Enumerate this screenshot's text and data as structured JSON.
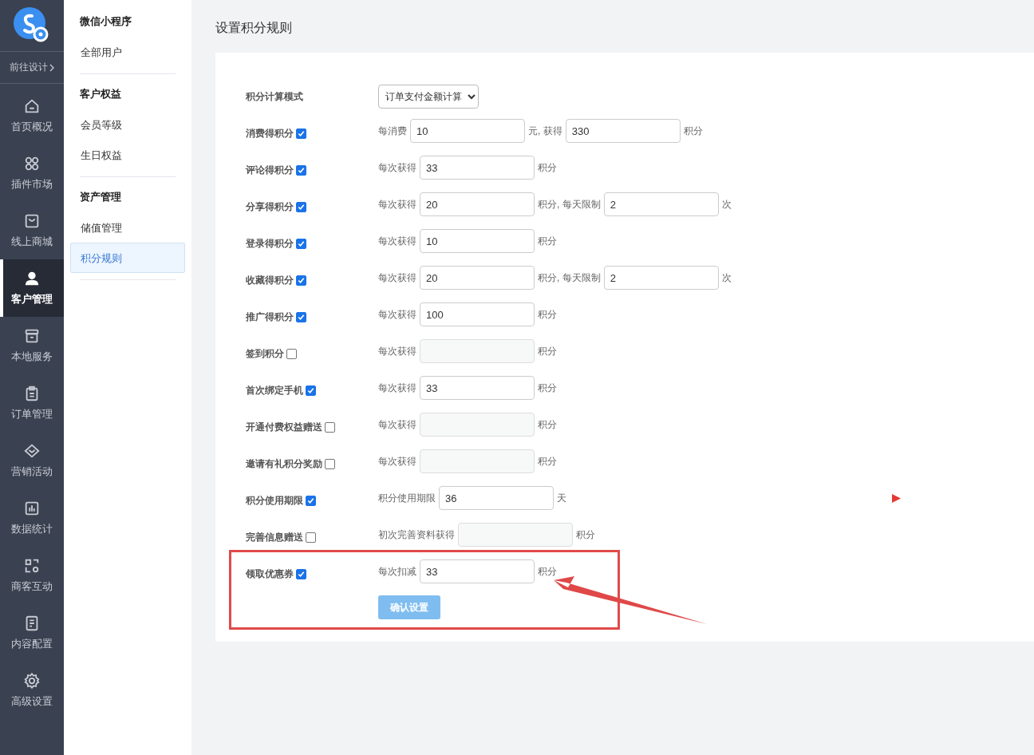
{
  "rail": {
    "design_link": "前往设计",
    "items": [
      {
        "label": "首页概况",
        "selected": false
      },
      {
        "label": "插件市场",
        "selected": false
      },
      {
        "label": "线上商城",
        "selected": false
      },
      {
        "label": "客户管理",
        "selected": true
      },
      {
        "label": "本地服务",
        "selected": false
      },
      {
        "label": "订单管理",
        "selected": false
      },
      {
        "label": "营销活动",
        "selected": false
      },
      {
        "label": "数据统计",
        "selected": false
      },
      {
        "label": "商客互动",
        "selected": false
      },
      {
        "label": "内容配置",
        "selected": false
      },
      {
        "label": "高级设置",
        "selected": false
      }
    ]
  },
  "subnav": {
    "groups": [
      {
        "title": "微信小程序",
        "items": [
          {
            "label": "全部用户",
            "selected": false
          }
        ]
      },
      {
        "title": "客户权益",
        "items": [
          {
            "label": "会员等级",
            "selected": false
          },
          {
            "label": "生日权益",
            "selected": false
          }
        ]
      },
      {
        "title": "资产管理",
        "items": [
          {
            "label": "储值管理",
            "selected": false
          },
          {
            "label": "积分规则",
            "selected": true
          }
        ]
      }
    ]
  },
  "page_title": "设置积分规则",
  "form": {
    "mode": {
      "label": "积分计算模式",
      "value": "订单支付金额计算"
    },
    "rows": [
      {
        "label": "消费得积分",
        "checked": true,
        "parts": [
          {
            "kind": "text",
            "text": "每消费"
          },
          {
            "kind": "input",
            "value": "10"
          },
          {
            "kind": "text",
            "text": "元, 获得"
          },
          {
            "kind": "input",
            "value": "330"
          },
          {
            "kind": "text",
            "text": "积分"
          }
        ]
      },
      {
        "label": "评论得积分",
        "checked": true,
        "parts": [
          {
            "kind": "text",
            "text": "每次获得"
          },
          {
            "kind": "input",
            "value": "33"
          },
          {
            "kind": "text",
            "text": "积分"
          }
        ]
      },
      {
        "label": "分享得积分",
        "checked": true,
        "parts": [
          {
            "kind": "text",
            "text": "每次获得"
          },
          {
            "kind": "input",
            "value": "20"
          },
          {
            "kind": "text",
            "text": "积分, 每天限制"
          },
          {
            "kind": "input",
            "value": "2"
          },
          {
            "kind": "text",
            "text": "次"
          }
        ]
      },
      {
        "label": "登录得积分",
        "checked": true,
        "parts": [
          {
            "kind": "text",
            "text": "每次获得"
          },
          {
            "kind": "input",
            "value": "10"
          },
          {
            "kind": "text",
            "text": "积分"
          }
        ]
      },
      {
        "label": "收藏得积分",
        "checked": true,
        "parts": [
          {
            "kind": "text",
            "text": "每次获得"
          },
          {
            "kind": "input",
            "value": "20"
          },
          {
            "kind": "text",
            "text": "积分, 每天限制"
          },
          {
            "kind": "input",
            "value": "2"
          },
          {
            "kind": "text",
            "text": "次"
          }
        ]
      },
      {
        "label": "推广得积分",
        "checked": true,
        "parts": [
          {
            "kind": "text",
            "text": "每次获得"
          },
          {
            "kind": "input",
            "value": "100"
          },
          {
            "kind": "text",
            "text": "积分"
          }
        ]
      },
      {
        "label": "签到积分",
        "checked": false,
        "parts": [
          {
            "kind": "text",
            "text": "每次获得"
          },
          {
            "kind": "input"
          },
          {
            "kind": "text",
            "text": "积分"
          }
        ]
      },
      {
        "label": "首次绑定手机",
        "checked": true,
        "parts": [
          {
            "kind": "text",
            "text": "每次获得"
          },
          {
            "kind": "input",
            "value": "33"
          },
          {
            "kind": "text",
            "text": "积分"
          }
        ]
      },
      {
        "label": "开通付费权益赠送",
        "checked": false,
        "parts": [
          {
            "kind": "text",
            "text": "每次获得"
          },
          {
            "kind": "input"
          },
          {
            "kind": "text",
            "text": "积分"
          }
        ]
      },
      {
        "label": "邀请有礼积分奖励",
        "checked": false,
        "parts": [
          {
            "kind": "text",
            "text": "每次获得"
          },
          {
            "kind": "input"
          },
          {
            "kind": "text",
            "text": "积分"
          }
        ]
      },
      {
        "label": "积分使用期限",
        "checked": true,
        "parts": [
          {
            "kind": "text",
            "text": "积分使用期限"
          },
          {
            "kind": "input",
            "value": "36"
          },
          {
            "kind": "text",
            "text": "天"
          }
        ]
      },
      {
        "label": "完善信息赠送",
        "checked": false,
        "parts": [
          {
            "kind": "text",
            "text": "初次完善资料获得"
          },
          {
            "kind": "input"
          },
          {
            "kind": "text",
            "text": "积分"
          }
        ]
      },
      {
        "label": "领取优惠券",
        "checked": true,
        "highlighted": true,
        "parts": [
          {
            "kind": "text",
            "text": "每次扣减"
          },
          {
            "kind": "input",
            "value": "33"
          },
          {
            "kind": "text",
            "text": "积分"
          }
        ]
      }
    ],
    "submit": "确认设置"
  }
}
